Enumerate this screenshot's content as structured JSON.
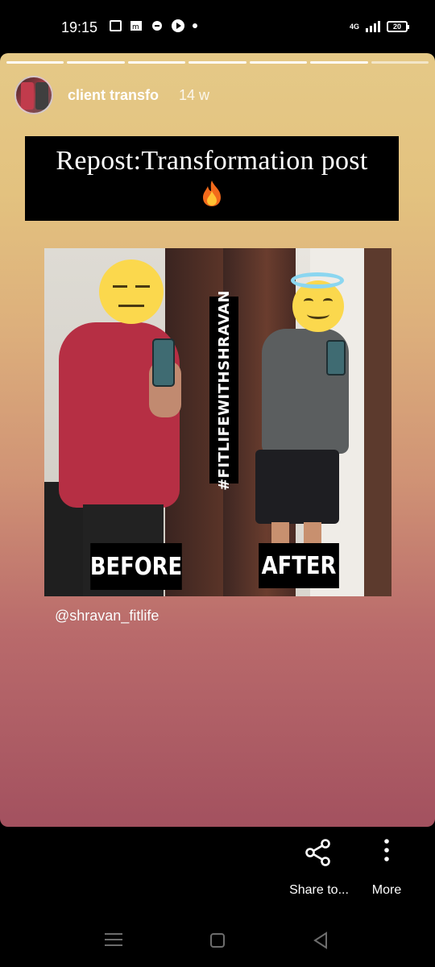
{
  "status_bar": {
    "time": "19:15",
    "network": "4G",
    "battery": "20"
  },
  "story": {
    "progress_total": 7,
    "progress_done": 6,
    "username": "client transfo",
    "time_ago": "14 w",
    "caption": "Repost:Transformation post",
    "caption_emoji": "fire-icon",
    "photo": {
      "hashtag": "#FITLIFEWITHSHRAVAN",
      "before_label": "BEFORE",
      "after_label": "AFTER"
    },
    "mention": "@shravan_fitlife"
  },
  "actions": {
    "share_label": "Share to...",
    "more_label": "More"
  },
  "colors": {
    "gradient_top": "#e5c987",
    "gradient_bottom": "#a3515f",
    "photo_shirt_before": "#b62f44",
    "halo": "#8bd6f0"
  }
}
